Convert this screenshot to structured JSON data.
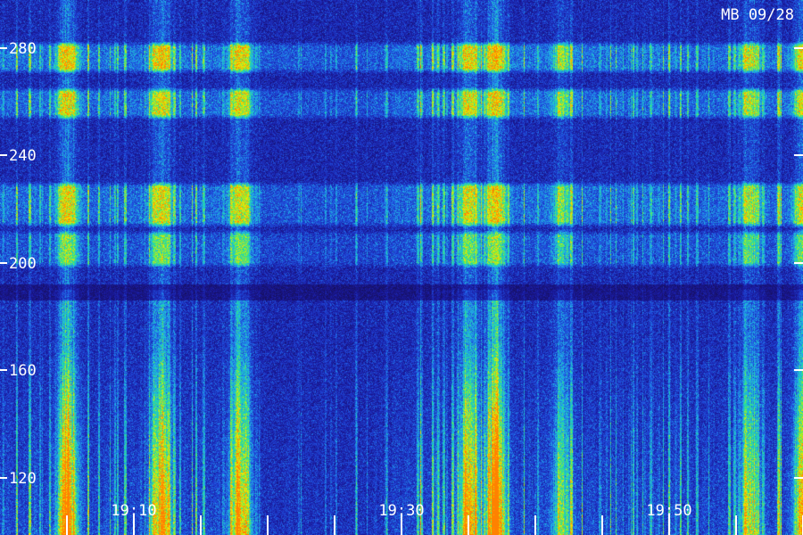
{
  "chart_data": {
    "type": "heatmap",
    "title": "MB 09/28",
    "xlabel": "",
    "ylabel": "",
    "ylim": [
      100,
      298
    ],
    "y_ticks": [
      "120",
      "160",
      "200",
      "240",
      "280"
    ],
    "x_ticks": [
      "19:10",
      "19:30",
      "19:50"
    ],
    "x_minor_ticks": [
      "19:00",
      "19:05",
      "19:10",
      "19:15",
      "19:20",
      "19:25",
      "19:30",
      "19:35",
      "19:40",
      "19:45",
      "19:50",
      "19:55"
    ],
    "colormap": [
      "#140a3c",
      "#1a1aa0",
      "#2050e0",
      "#20b0e8",
      "#20e0a0",
      "#a0f020",
      "#ffe000",
      "#ff8000"
    ],
    "activity_bands_y": [
      {
        "y_low": 272,
        "y_high": 280,
        "level": 0.55
      },
      {
        "y_low": 255,
        "y_high": 263,
        "level": 0.5
      },
      {
        "y_low": 215,
        "y_high": 228,
        "level": 0.5
      },
      {
        "y_low": 200,
        "y_high": 210,
        "level": 0.35
      }
    ],
    "activity_columns_x": [
      {
        "time": "19:00",
        "level": 0.9
      },
      {
        "time": "19:07",
        "level": 0.7
      },
      {
        "time": "19:13",
        "level": 0.8
      },
      {
        "time": "19:30",
        "level": 0.75
      },
      {
        "time": "19:32",
        "level": 0.95
      },
      {
        "time": "19:37",
        "level": 0.4
      },
      {
        "time": "19:51",
        "level": 0.45
      },
      {
        "time": "19:55",
        "level": 0.7
      }
    ]
  }
}
